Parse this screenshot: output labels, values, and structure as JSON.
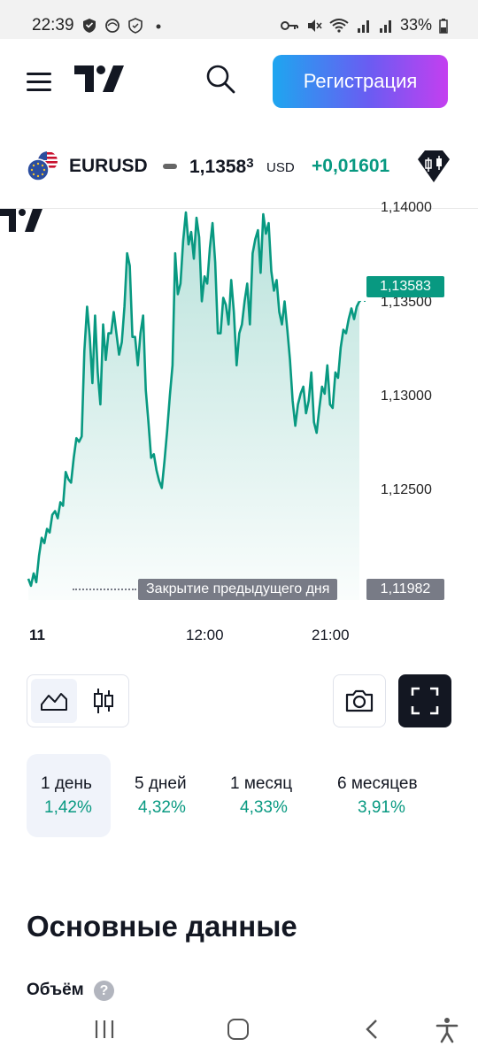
{
  "status_bar": {
    "time": "22:39",
    "battery": "33%"
  },
  "header": {
    "register_label": "Регистрация"
  },
  "symbol": {
    "name": "EURUSD",
    "price_main": "1,1358",
    "price_sup": "3",
    "currency": "USD",
    "change": "+0,01601"
  },
  "chart_data": {
    "type": "area",
    "x_ticks": [
      "11",
      "12:00",
      "21:00"
    ],
    "y_ticks": [
      "1,14000",
      "1,13500",
      "1,13000",
      "1,12500"
    ],
    "last_price": "1,13583",
    "prev_close_label": "Закрытие предыдущего дня",
    "prev_close": "1,11982",
    "colors": {
      "line": "#089981",
      "fill_top": "#089981",
      "prev_close": "#787b86"
    },
    "values": [
      1.1202,
      1.1198,
      1.1205,
      1.12,
      1.1215,
      1.1225,
      1.1222,
      1.123,
      1.1228,
      1.1238,
      1.124,
      1.1236,
      1.1245,
      1.1243,
      1.1262,
      1.1258,
      1.1256,
      1.127,
      1.1281,
      1.1279,
      1.1282,
      1.133,
      1.1355,
      1.1338,
      1.1312,
      1.135,
      1.1318,
      1.13,
      1.1345,
      1.1325,
      1.134,
      1.134,
      1.1352,
      1.134,
      1.1328,
      1.1335,
      1.1355,
      1.1385,
      1.1378,
      1.1338,
      1.1338,
      1.1322,
      1.134,
      1.135,
      1.1308,
      1.129,
      1.127,
      1.1272,
      1.1263,
      1.1257,
      1.1253,
      1.1268,
      1.1285,
      1.1305,
      1.1322,
      1.1385,
      1.1362,
      1.1368,
      1.1392,
      1.1408,
      1.139,
      1.1397,
      1.1382,
      1.1405,
      1.1394,
      1.1358,
      1.1372,
      1.1368,
      1.1388,
      1.1402,
      1.138,
      1.134,
      1.134,
      1.136,
      1.1356,
      1.1345,
      1.137,
      1.1352,
      1.1322,
      1.134,
      1.1345,
      1.1358,
      1.1368,
      1.1345,
      1.1385,
      1.1393,
      1.1398,
      1.1374,
      1.1407,
      1.1396,
      1.1402,
      1.1375,
      1.1364,
      1.137,
      1.1352,
      1.1345,
      1.1358,
      1.1342,
      1.1325,
      1.1302,
      1.1288,
      1.13,
      1.1306,
      1.131,
      1.1295,
      1.1302,
      1.1318,
      1.129,
      1.1284,
      1.1298,
      1.131,
      1.1306,
      1.1322,
      1.13,
      1.1298,
      1.1318,
      1.1315,
      1.1332,
      1.1342,
      1.134,
      1.1348,
      1.1354,
      1.1348,
      1.1355,
      1.1358
    ],
    "ylim": [
      1.119,
      1.141
    ]
  },
  "periods": [
    {
      "name": "1 день",
      "value": "1,42%"
    },
    {
      "name": "5 дней",
      "value": "4,32%"
    },
    {
      "name": "1 месяц",
      "value": "4,33%"
    },
    {
      "name": "6 месяцев",
      "value": "3,91%"
    }
  ],
  "fundamentals": {
    "title": "Основные данные",
    "volume_label": "Объём",
    "help": "?"
  },
  "icons": [
    "hamburger-icon",
    "tradingview-logo",
    "search-icon",
    "flag-icon",
    "diamond-icon",
    "area-chart-icon",
    "candles-icon",
    "camera-icon",
    "fullscreen-icon",
    "help-icon"
  ]
}
